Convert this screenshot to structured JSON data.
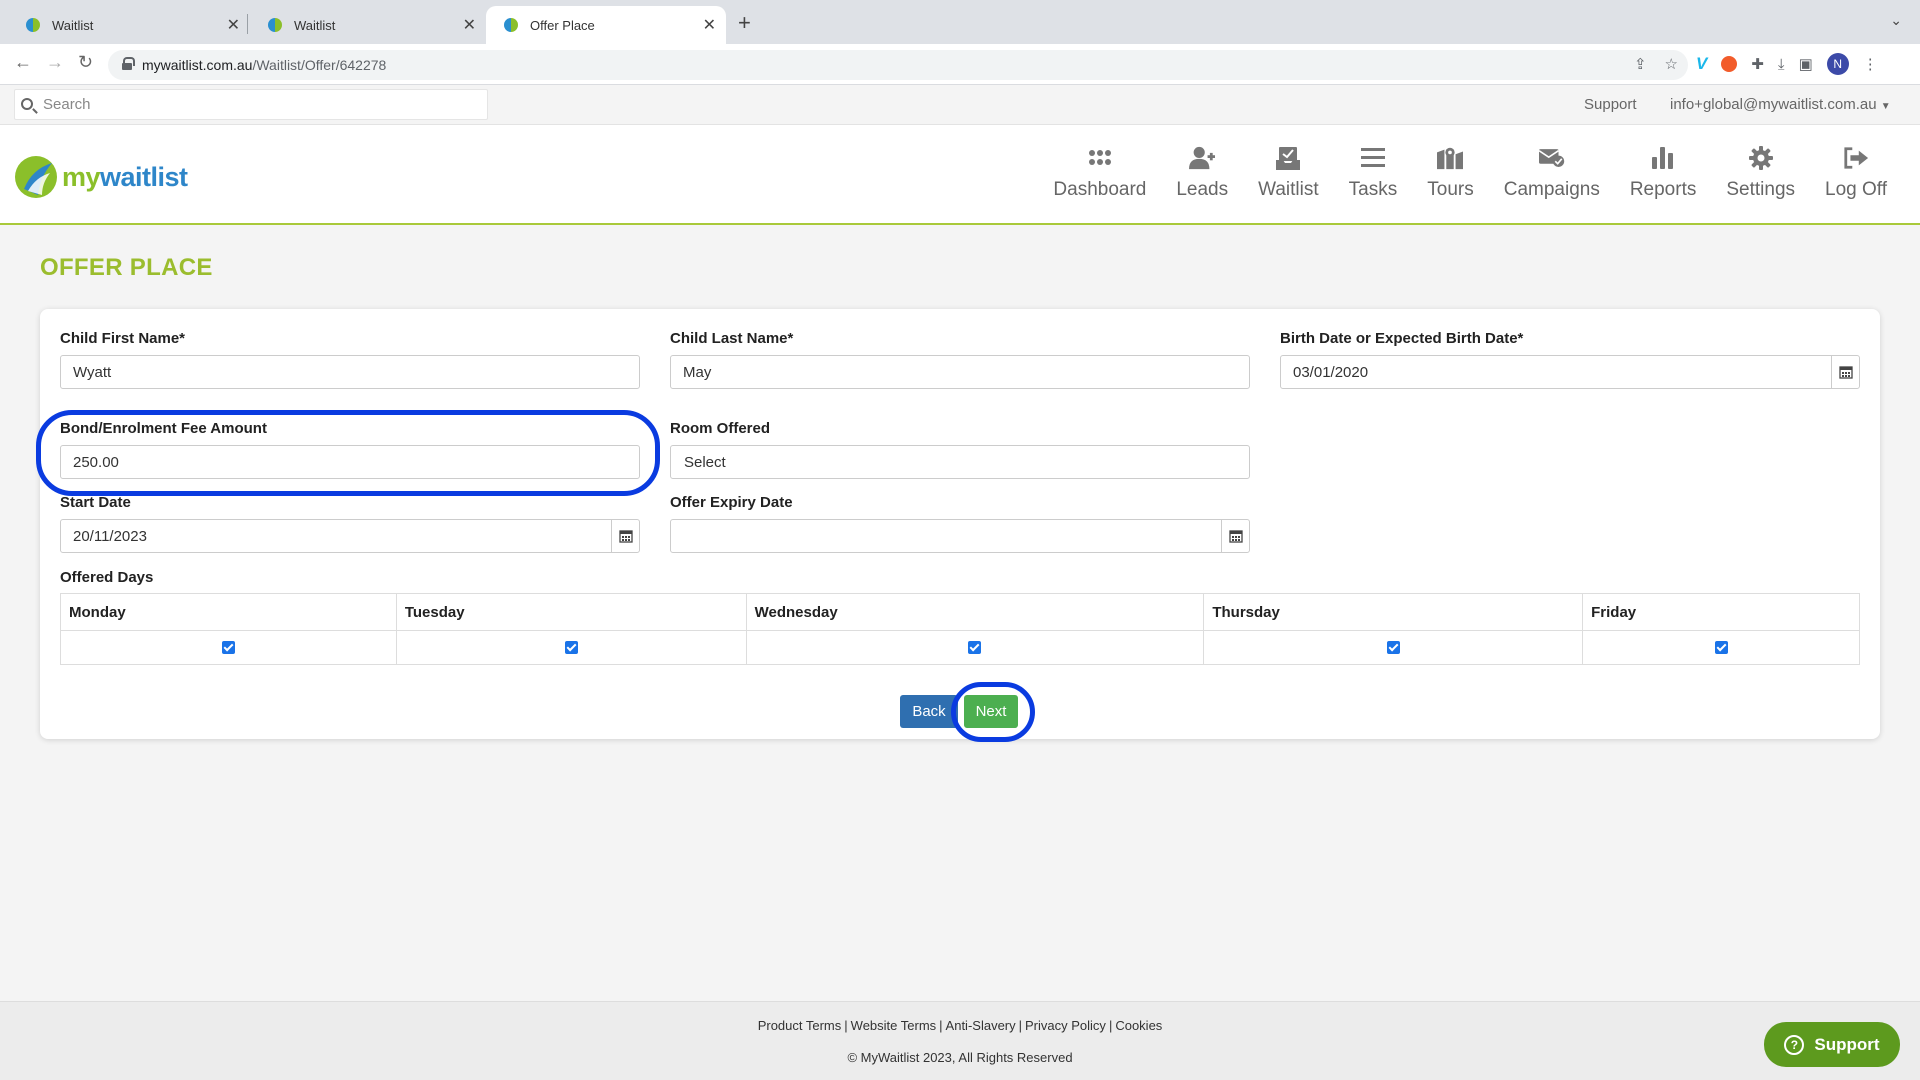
{
  "browser": {
    "tabs": [
      {
        "title": "Waitlist",
        "active": false
      },
      {
        "title": "Waitlist",
        "active": false
      },
      {
        "title": "Offer Place",
        "active": true
      }
    ],
    "url_host": "mywaitlist.com.au",
    "url_path": "/Waitlist/Offer/642278",
    "profile_initial": "N"
  },
  "topbar": {
    "search_placeholder": "Search",
    "support_label": "Support",
    "account_label": "info+global@mywaitlist.com.au"
  },
  "logo": {
    "text_my": "my",
    "text_rest": "waitlist"
  },
  "nav": [
    {
      "label": "Dashboard",
      "icon": "grid-icon"
    },
    {
      "label": "Leads",
      "icon": "user-plus-icon"
    },
    {
      "label": "Waitlist",
      "icon": "inbox-icon"
    },
    {
      "label": "Tasks",
      "icon": "list-icon"
    },
    {
      "label": "Tours",
      "icon": "map-icon"
    },
    {
      "label": "Campaigns",
      "icon": "envelope-check-icon"
    },
    {
      "label": "Reports",
      "icon": "bar-chart-icon"
    },
    {
      "label": "Settings",
      "icon": "gear-icon"
    },
    {
      "label": "Log Off",
      "icon": "sign-out-icon"
    }
  ],
  "page": {
    "title": "OFFER PLACE"
  },
  "form": {
    "child_first_name": {
      "label": "Child First Name*",
      "value": "Wyatt"
    },
    "child_last_name": {
      "label": "Child Last Name*",
      "value": "May"
    },
    "birth_date": {
      "label": "Birth Date or Expected Birth Date*",
      "value": "03/01/2020"
    },
    "bond_fee": {
      "label": "Bond/Enrolment Fee Amount",
      "value": "250.00"
    },
    "room_offered": {
      "label": "Room Offered",
      "value": "Select"
    },
    "start_date": {
      "label": "Start Date",
      "value": "20/11/2023"
    },
    "offer_expiry": {
      "label": "Offer Expiry Date",
      "value": ""
    },
    "offered_days": {
      "label": "Offered Days",
      "days": [
        {
          "name": "Monday",
          "checked": true
        },
        {
          "name": "Tuesday",
          "checked": true
        },
        {
          "name": "Wednesday",
          "checked": true
        },
        {
          "name": "Thursday",
          "checked": true
        },
        {
          "name": "Friday",
          "checked": true
        }
      ]
    },
    "back_label": "Back",
    "next_label": "Next"
  },
  "footer": {
    "links": [
      "Product Terms",
      "Website Terms",
      "Anti-Slavery",
      "Privacy Policy",
      "Cookies"
    ],
    "copyright": "© MyWaitlist 2023, All Rights Reserved"
  },
  "support_button": {
    "label": "Support"
  },
  "colors": {
    "brand_green": "#9bbd2e",
    "brand_blue": "#2e86c9",
    "back_button": "#2f6fb0",
    "next_button": "#4caf50",
    "highlight_ring": "#0a3be0"
  }
}
